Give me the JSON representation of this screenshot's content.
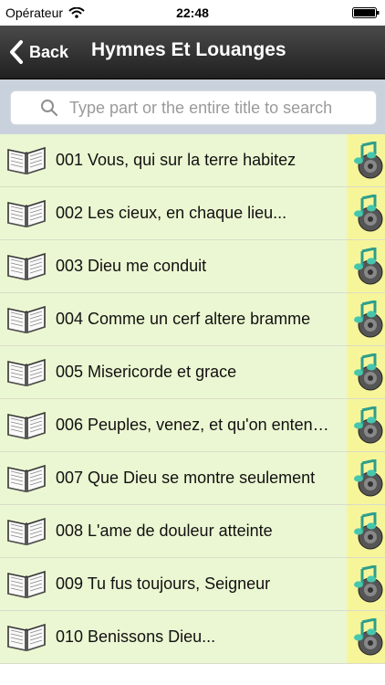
{
  "status": {
    "carrier": "Opérateur",
    "time": "22:48"
  },
  "nav": {
    "back_label": "Back",
    "title": "Hymnes Et Louanges"
  },
  "search": {
    "placeholder": "Type part or the entire title to search"
  },
  "colors": {
    "row_bg": "#ebf7d2",
    "audio_bg": "#f7f59a",
    "navbar": "#2b2b2b"
  },
  "hymns": [
    {
      "title": "001 Vous, qui sur la terre habitez",
      "icon": "book-icon",
      "action_icon": "music-note-speaker-icon"
    },
    {
      "title": "002 Les cieux, en chaque lieu...",
      "icon": "book-icon",
      "action_icon": "music-note-speaker-icon"
    },
    {
      "title": "003 Dieu me conduit",
      "icon": "book-icon",
      "action_icon": "music-note-speaker-icon"
    },
    {
      "title": "004 Comme un cerf altere bramme",
      "icon": "book-icon",
      "action_icon": "music-note-speaker-icon"
    },
    {
      "title": "005 Misericorde et grace",
      "icon": "book-icon",
      "action_icon": "music-note-speaker-icon"
    },
    {
      "title": "006 Peuples, venez, et qu'on enten…",
      "icon": "book-icon",
      "action_icon": "music-note-speaker-icon"
    },
    {
      "title": "007 Que Dieu se montre seulement",
      "icon": "book-icon",
      "action_icon": "music-note-speaker-icon"
    },
    {
      "title": "008 L'ame de douleur atteinte",
      "icon": "book-icon",
      "action_icon": "music-note-speaker-icon"
    },
    {
      "title": "009 Tu fus toujours, Seigneur",
      "icon": "book-icon",
      "action_icon": "music-note-speaker-icon"
    },
    {
      "title": "010 Benissons Dieu...",
      "icon": "book-icon",
      "action_icon": "music-note-speaker-icon"
    }
  ]
}
